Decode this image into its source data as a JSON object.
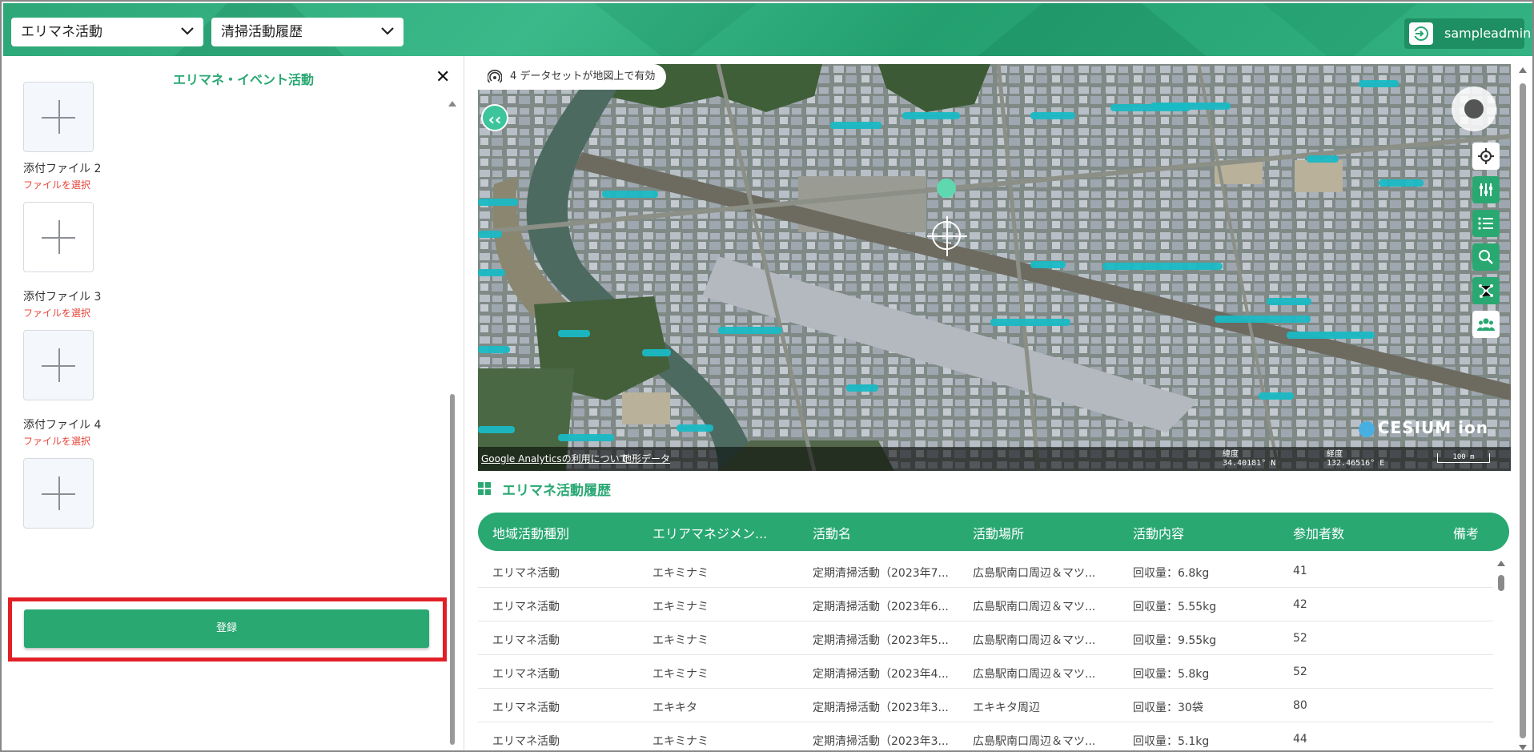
{
  "header": {
    "select1": "エリマネ活動",
    "select2": "清掃活動履歴",
    "user": "sampleadmin"
  },
  "panel": {
    "title": "エリマネ・イベント活動",
    "close": "✕",
    "attachments": [
      {
        "label": "添付ファイル 2",
        "action": "ファイルを選択"
      },
      {
        "label": "添付ファイル 3",
        "action": "ファイルを選択"
      },
      {
        "label": "添付ファイル 4",
        "action": "ファイルを選択"
      }
    ],
    "register": "登録"
  },
  "map": {
    "datasets": "4 データセットが地図上で有効",
    "collapse": "‹‹",
    "footer": {
      "analytics": "Google Analyticsの利用について",
      "terrain": "地形データ",
      "lat_label": "緯度",
      "lat_value": "34.40181° N",
      "lon_label": "経度",
      "lon_value": "132.46516° E",
      "scale": "100 m"
    },
    "logo": "CESIUM ion",
    "colors": {
      "tag": "#1ab9c4",
      "accent": "#2aa872"
    }
  },
  "history": {
    "title": "エリマネ活動履歴",
    "columns": [
      "地域活動種別",
      "エリアマネジメン...",
      "活動名",
      "活動場所",
      "活動内容",
      "参加者数",
      "備考"
    ],
    "rows": [
      [
        "エリマネ活動",
        "エキミナミ",
        "定期清掃活動（2023年7...",
        "広島駅南口周辺＆マツ...",
        "回収量：6.8kg",
        "41",
        ""
      ],
      [
        "エリマネ活動",
        "エキミナミ",
        "定期清掃活動（2023年6...",
        "広島駅南口周辺＆マツ...",
        "回収量：5.55kg",
        "42",
        ""
      ],
      [
        "エリマネ活動",
        "エキミナミ",
        "定期清掃活動（2023年5...",
        "広島駅南口周辺＆マツ...",
        "回収量：9.55kg",
        "52",
        ""
      ],
      [
        "エリマネ活動",
        "エキミナミ",
        "定期清掃活動（2023年4...",
        "広島駅南口周辺＆マツ...",
        "回収量：5.8kg",
        "52",
        ""
      ],
      [
        "エリマネ活動",
        "エキキタ",
        "定期清掃活動（2023年3...",
        "エキキタ周辺",
        "回収量：30袋",
        "80",
        ""
      ],
      [
        "エリマネ活動",
        "エキミナミ",
        "定期清掃活動（2023年3...",
        "広島駅南口周辺＆マツ...",
        "回収量：5.1kg",
        "44",
        ""
      ]
    ]
  }
}
